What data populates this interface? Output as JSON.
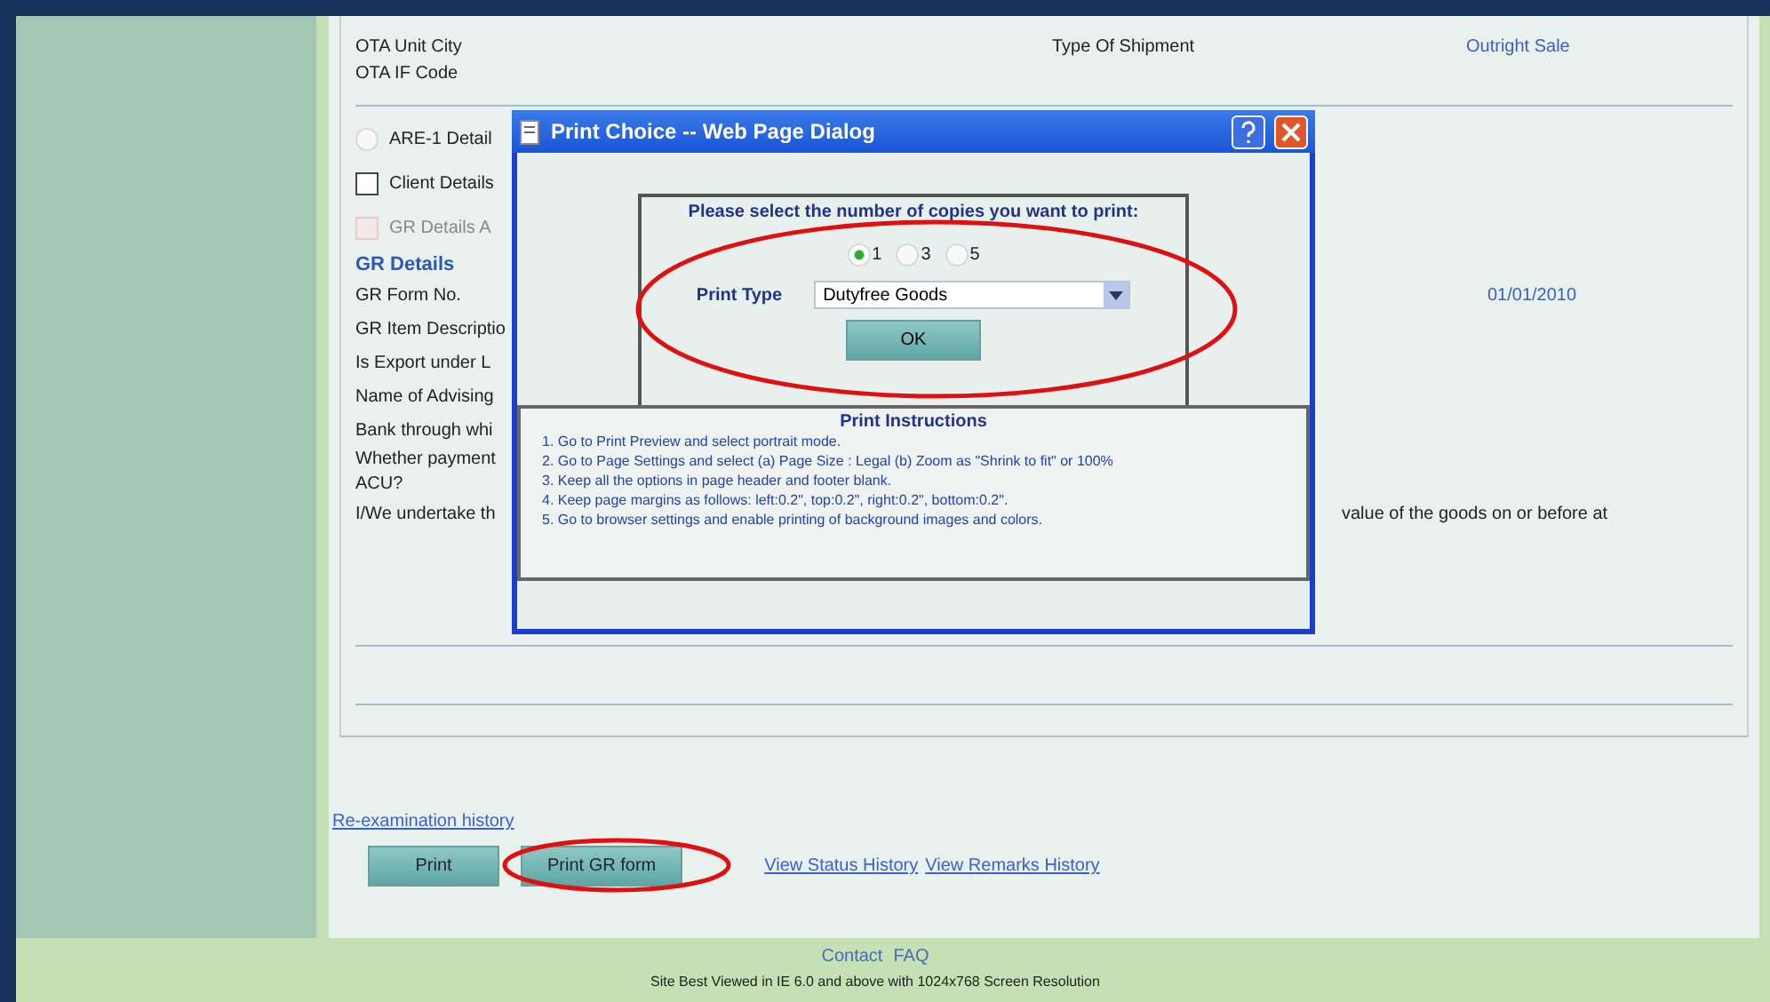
{
  "shipment_rows": [
    {
      "label": "OTA Unit City",
      "field": "Type Of Shipment",
      "value": "Outright Sale"
    },
    {
      "label": "OTA IF Code"
    }
  ],
  "options": [
    {
      "kind": "radio",
      "label": "ARE-1 Detail",
      "checked": false,
      "disabled": false
    },
    {
      "kind": "checkbox",
      "label": "Client Details",
      "checked": false,
      "disabled": false
    },
    {
      "kind": "checkbox",
      "label": "GR Details A",
      "checked": false,
      "disabled": true
    }
  ],
  "gr_section": {
    "heading": "GR Details",
    "rows": [
      {
        "kind": "value",
        "label": "GR Form No.",
        "value": "01/01/2010"
      },
      {
        "kind": "plain",
        "label": "GR Item Descriptio"
      },
      {
        "kind": "plain",
        "label": "Is Export under L"
      },
      {
        "kind": "plain",
        "label": "Name of Advising"
      },
      {
        "kind": "plain",
        "label": "Bank through whi"
      },
      {
        "kind": "plain",
        "label": "Whether payment",
        "label_line2": "ACU?"
      },
      {
        "kind": "continuation",
        "label": "I/We undertake th",
        "value": "value of the goods on or before at"
      }
    ]
  },
  "history_link": "Re-examination history",
  "buttons": [
    {
      "label": "Print",
      "highlighted": false
    },
    {
      "label": "Print GR form",
      "highlighted": true
    }
  ],
  "links": [
    "View Status History",
    "View Remarks History"
  ],
  "footer": {
    "links": [
      "Contact",
      "FAQ"
    ],
    "note": "Site Best Viewed in IE 6.0 and above with 1024x768 Screen Resolution"
  },
  "dialog": {
    "title": "Print Choice -- Web Page Dialog",
    "prompt": "Please select the number of copies you want to print:",
    "copies": [
      {
        "label": "1",
        "selected": true
      },
      {
        "label": "3",
        "selected": false
      },
      {
        "label": "5",
        "selected": false
      }
    ],
    "print_type": {
      "label": "Print Type",
      "value": "Dutyfree Goods"
    },
    "ok": "OK",
    "highlighted": true,
    "instructions": {
      "title": "Print Instructions",
      "items": [
        "1. Go to Print Preview and select portrait mode.",
        "2. Go to Page Settings and select (a) Page Size : Legal (b) Zoom as \"Shrink to fit\" or 100%",
        "3. Keep all the options in page header and footer blank.",
        "4. Keep page margins as follows: left:0.2\", top:0.2\", right:0.2\", bottom:0.2\".",
        "5. Go to browser settings and enable printing of background images and colors."
      ]
    }
  }
}
